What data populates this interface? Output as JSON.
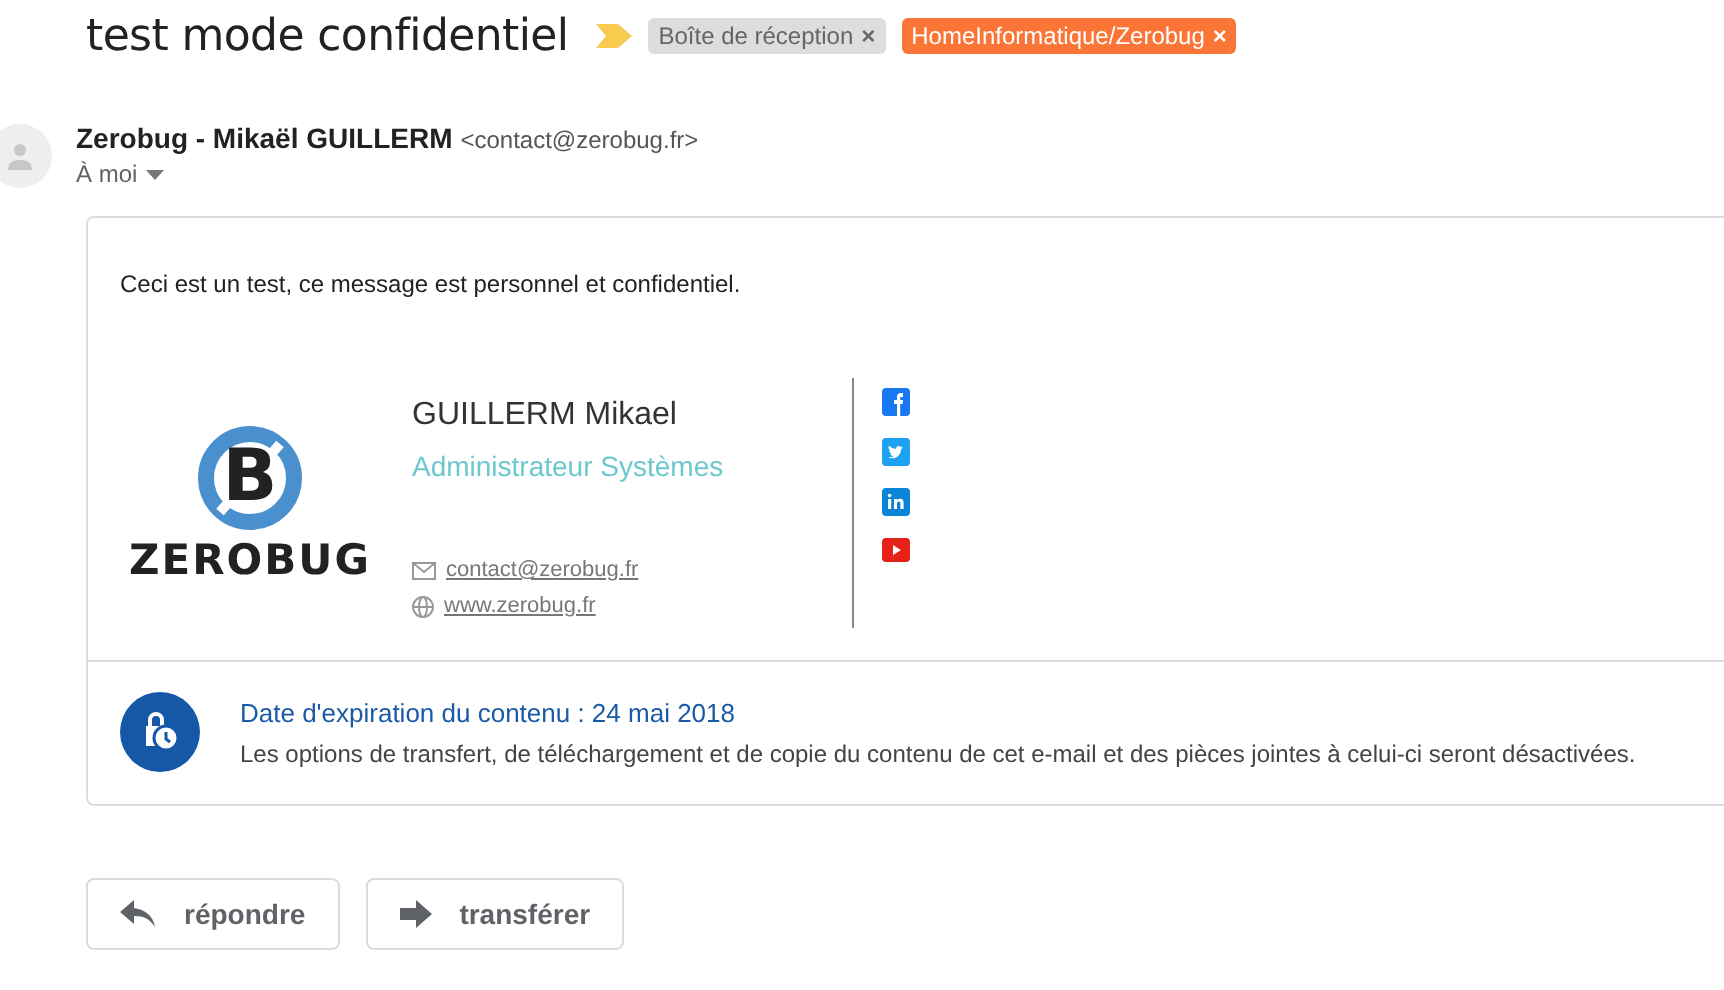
{
  "subject": "test mode confidentiel",
  "important": true,
  "labels": [
    {
      "text": "Boîte de réception",
      "close": "×",
      "color": "#dddddd"
    },
    {
      "text": "HomeInformatique/Zerobug",
      "close": "×",
      "color": "#fb7537"
    }
  ],
  "sender": {
    "name": "Zerobug - Mikaël GUILLERM",
    "email": "<contact@zerobug.fr>",
    "to": "À moi"
  },
  "body": "Ceci est un test, ce message est personnel et confidentiel.",
  "signature": {
    "logo_letter": "B",
    "logo_text": "ZEROBUG",
    "name": "GUILLERM Mikael",
    "role": "Administrateur Systèmes",
    "email": "contact@zerobug.fr",
    "website": "www.zerobug.fr",
    "social": [
      {
        "kind": "facebook"
      },
      {
        "kind": "twitter"
      },
      {
        "kind": "linkedin"
      },
      {
        "kind": "youtube"
      }
    ]
  },
  "expiration": {
    "title": "Date d'expiration du contenu : 24 mai 2018",
    "note": "Les options de transfert, de téléchargement et de copie du contenu de cet e-mail et des pièces jointes à celui-ci seront désactivées."
  },
  "buttons": [
    {
      "kind": "reply",
      "label": "répondre"
    },
    {
      "kind": "forward",
      "label": "transférer"
    }
  ]
}
